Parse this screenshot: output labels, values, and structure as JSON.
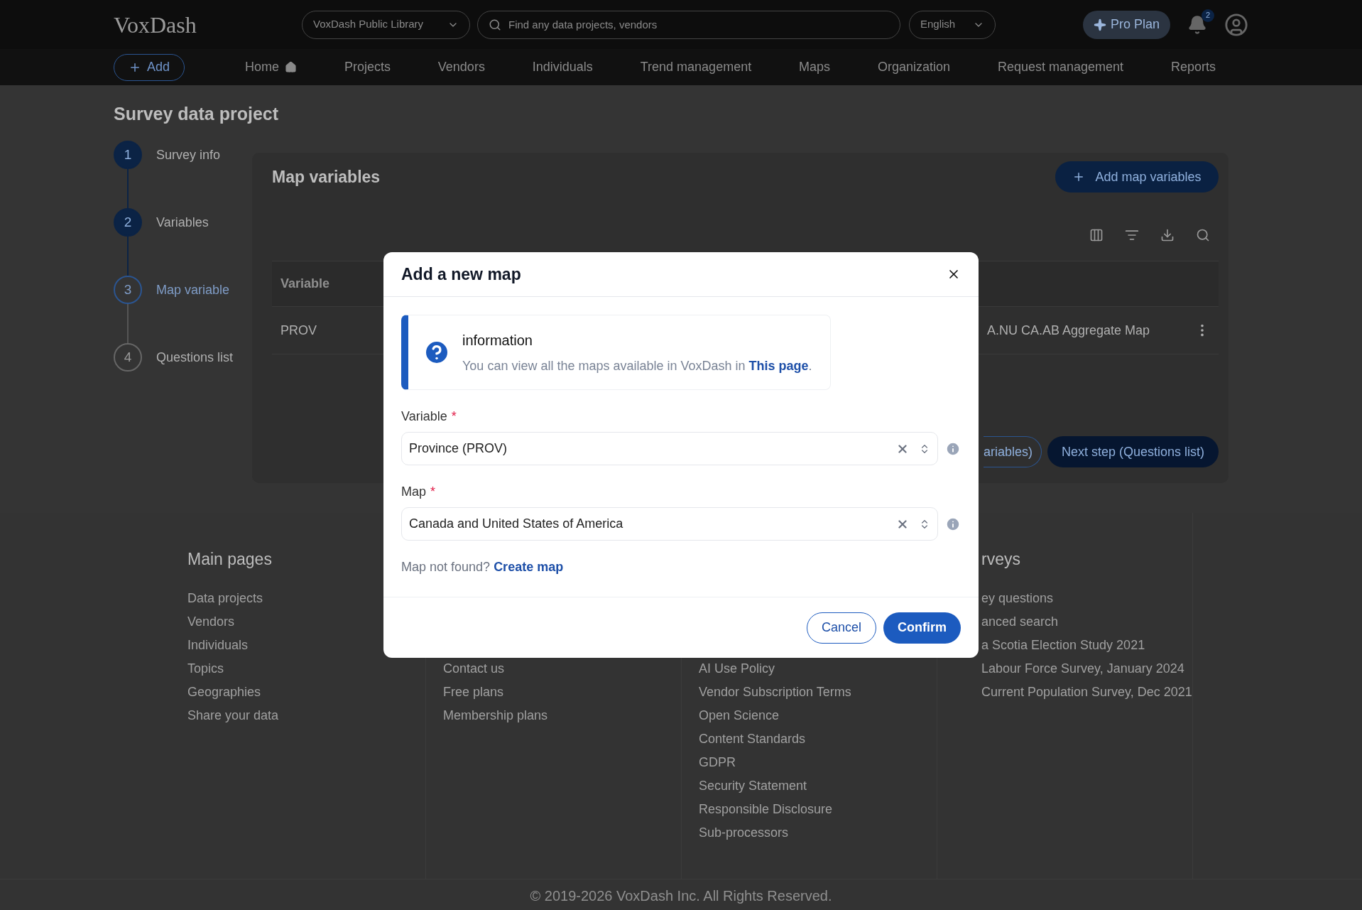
{
  "header": {
    "logo": "VoxDash",
    "library": "VoxDash Public Library",
    "search": {
      "placeholder": "Find any data projects, vendors"
    },
    "language": "English",
    "pro_plan": "Pro Plan",
    "notification_count": "2"
  },
  "nav": {
    "add_button": "Add",
    "items": [
      {
        "label": "Home",
        "kind": "home"
      },
      {
        "label": "Projects",
        "kind": "link"
      },
      {
        "label": "Vendors",
        "kind": "link"
      },
      {
        "label": "Individuals",
        "kind": "link"
      },
      {
        "label": "Trend management",
        "kind": "link"
      },
      {
        "label": "Maps",
        "kind": "link"
      },
      {
        "label": "Organization",
        "kind": "link"
      },
      {
        "label": "Request management",
        "kind": "link"
      },
      {
        "label": "Reports",
        "kind": "link"
      }
    ]
  },
  "page_title": "Survey data project",
  "steps": [
    {
      "number": "1",
      "label": "Survey info",
      "completed": true,
      "selected": false
    },
    {
      "number": "2",
      "label": "Variables",
      "completed": true,
      "selected": false
    },
    {
      "number": "3",
      "label": "Map variable",
      "completed": false,
      "selected": true
    },
    {
      "number": "4",
      "label": "Questions list",
      "completed": false,
      "selected": false
    }
  ],
  "card": {
    "title": "Map variables",
    "add_button": "Add map variables",
    "table": {
      "columns": [
        "Variable"
      ],
      "rows": [
        {
          "cells": [
            "PROV",
            "A.NU CA.AB Aggregate Map"
          ]
        }
      ]
    },
    "previous_button": "ariables)",
    "next_button": "Next step (Questions list)"
  },
  "modal": {
    "title": "Add a new map",
    "info": {
      "title": "information",
      "text": "You can view all the maps available in VoxDash in ",
      "link": "This page",
      "text_end": "."
    },
    "fields": [
      {
        "label": "Variable",
        "required_mark": "*",
        "value": "Province (PROV)"
      },
      {
        "label": "Map",
        "required_mark": "*",
        "value": "Canada and United States of America"
      }
    ],
    "hint": "Map not found?",
    "hint_link": "Create map",
    "buttons": [
      {
        "label": "Cancel",
        "kind": "secondary"
      },
      {
        "label": "Confirm",
        "kind": "primary"
      }
    ]
  },
  "footer": {
    "columns": [
      {
        "title": "Main pages",
        "links": [
          "Data projects",
          "Vendors",
          "Individuals",
          "Topics",
          "Geographies",
          "Share your data"
        ]
      },
      {
        "links": [
          "Contact us",
          "Free plans",
          "Membership plans"
        ]
      },
      {
        "links": [
          "AI Use Policy",
          "Vendor Subscription Terms",
          "Open Science",
          "Content Standards",
          "GDPR",
          "Security Statement",
          "Responsible Disclosure",
          "Sub-processors"
        ]
      },
      {
        "title": "rveys",
        "links": [
          "ey questions",
          "anced search",
          "a Scotia Election Study 2021",
          "Labour Force Survey, January 2024",
          "Current Population Survey, Dec 2021"
        ]
      }
    ],
    "copyright": "© 2019-2026 VoxDash Inc. All Rights Reserved."
  }
}
